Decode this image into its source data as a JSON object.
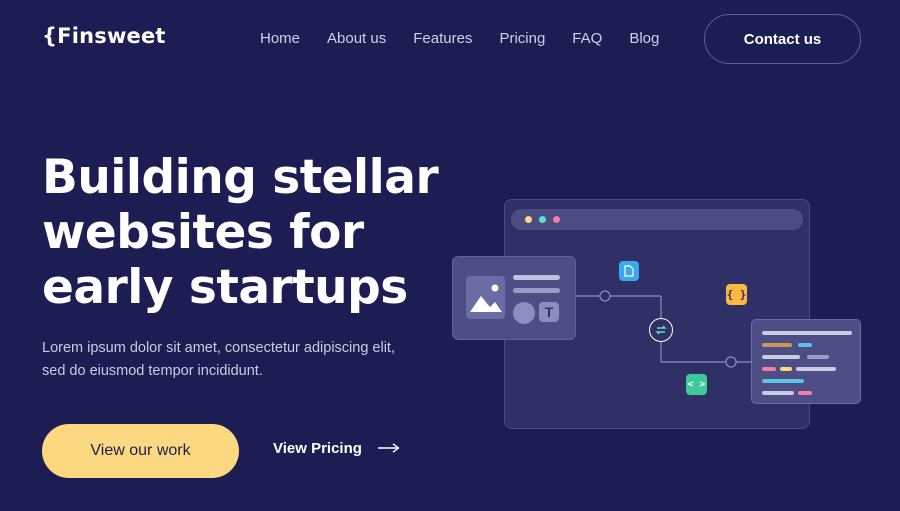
{
  "header": {
    "logo": "{Finsweet",
    "nav": [
      "Home",
      "About us",
      "Features",
      "Pricing",
      "FAQ",
      "Blog"
    ],
    "contact_label": "Contact us"
  },
  "hero": {
    "title_lines": [
      "Building stellar",
      "websites for",
      "early startups"
    ],
    "description_lines": [
      "Lorem ipsum dolor sit amet, consectetur adipiscing elit,",
      "sed do eiusmod tempor incididunt."
    ],
    "primary_cta": "View our work",
    "secondary_cta": "View Pricing"
  },
  "illustration": {
    "code_card_label": "{ }",
    "code_icon_label": "< >",
    "text_icon_label": "T"
  },
  "colors": {
    "background": "#1c1e53",
    "accent_yellow": "#fcd980",
    "accent_green": "#5ce0c0",
    "accent_pink": "#f27fa3",
    "accent_blue": "#3aa7f0",
    "accent_orange": "#fcb843",
    "accent_teal": "#3fc99a"
  }
}
